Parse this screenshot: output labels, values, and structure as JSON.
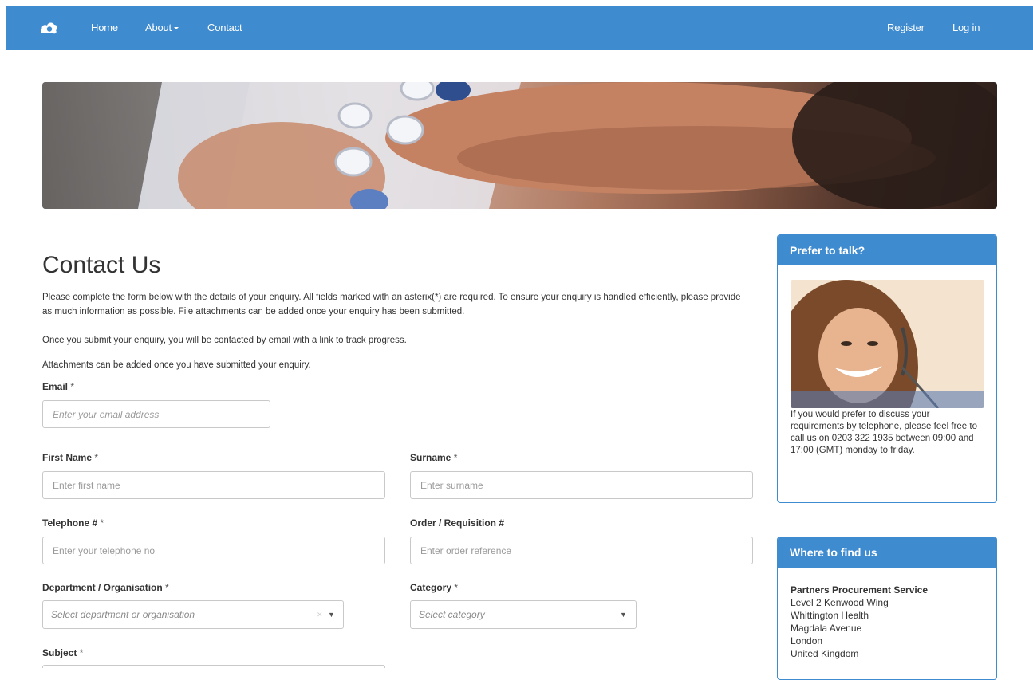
{
  "nav": {
    "left_links": [
      "Home",
      "About",
      "Contact"
    ],
    "right_links": [
      "Register",
      "Log in"
    ]
  },
  "page": {
    "title": "Contact Us",
    "intro": [
      "Please complete the form below with the details of your enquiry. All fields marked with an asterix(*) are required. To ensure your enquiry is handled efficiently, please provide as much information as possible. File attachments can be added once your enquiry has been submitted.",
      "Once you submit your enquiry, you will be contacted by email with a link to track progress.",
      "Attachments can be added once you have submitted your enquiry."
    ]
  },
  "form": {
    "email": {
      "label": "Email",
      "placeholder": "Enter your email address"
    },
    "first_name": {
      "label": "First Name",
      "placeholder": "Enter first name"
    },
    "surname": {
      "label": "Surname",
      "placeholder": "Enter surname"
    },
    "telephone": {
      "label": "Telephone #",
      "placeholder": "Enter your telephone no"
    },
    "order_ref": {
      "label": "Order / Requisition #",
      "placeholder": "Enter order reference"
    },
    "department": {
      "label": "Department / Organisation",
      "placeholder": "Select department or organisation"
    },
    "category": {
      "label": "Category",
      "placeholder": "Select category"
    },
    "subject": {
      "label": "Subject"
    },
    "required_marker": "*"
  },
  "sidebar": {
    "talk": {
      "title": "Prefer to talk?",
      "text": "If you would prefer to discuss your requirements by telephone, please feel free to call us on 0203 322 1935 between 09:00 and 17:00 (GMT) monday to friday."
    },
    "find": {
      "title": "Where to find us",
      "org": "Partners Procurement Service",
      "address": [
        "Level 2 Kenwood Wing",
        "Whittington Health",
        "Magdala Avenue",
        "London",
        "United Kingdom"
      ]
    }
  },
  "colors": {
    "brand": "#3f8bd0"
  }
}
